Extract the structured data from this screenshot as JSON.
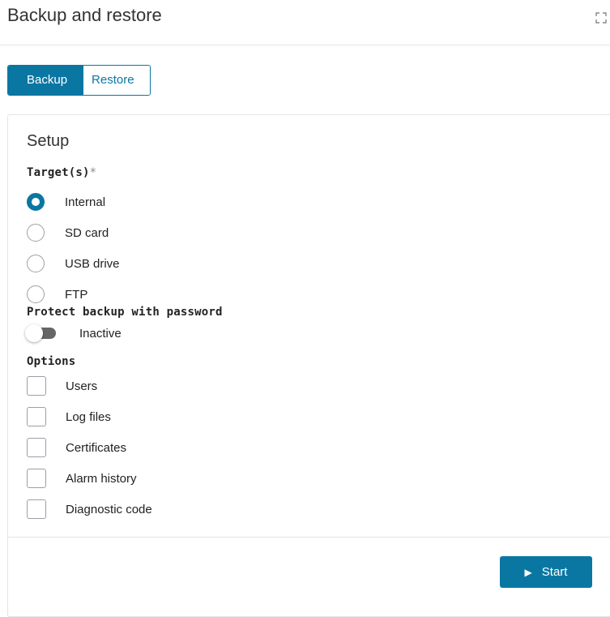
{
  "header": {
    "title": "Backup and restore"
  },
  "tabs": [
    {
      "label": "Backup",
      "active": true
    },
    {
      "label": "Restore",
      "active": false
    }
  ],
  "setup": {
    "title": "Setup",
    "targets_label": "Target(s)",
    "required_mark": "*",
    "targets": [
      {
        "label": "Internal",
        "selected": true
      },
      {
        "label": "SD card",
        "selected": false
      },
      {
        "label": "USB drive",
        "selected": false
      },
      {
        "label": "FTP",
        "selected": false
      }
    ],
    "password_label": "Protect backup with password",
    "password_toggle_state": "Inactive",
    "options_label": "Options",
    "options": [
      {
        "label": "Users",
        "checked": false
      },
      {
        "label": "Log files",
        "checked": false
      },
      {
        "label": "Certificates",
        "checked": false
      },
      {
        "label": "Alarm history",
        "checked": false
      },
      {
        "label": "Diagnostic code",
        "checked": false
      }
    ]
  },
  "actions": {
    "start_label": "Start"
  },
  "colors": {
    "accent": "#0a77a3",
    "border": "#e4e4e4"
  }
}
